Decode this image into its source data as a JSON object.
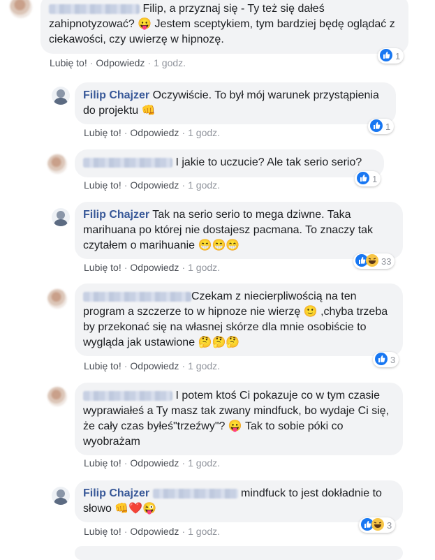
{
  "actions": {
    "like": "Lubię to!",
    "reply": "Odpowiedz",
    "time": "1 godz."
  },
  "colors": {
    "author": "#385898",
    "bubble": "#f2f3f5",
    "like_blue": "#1877f2"
  },
  "comments": [
    {
      "author": "",
      "text": "Filip, a przyznaj się - Ty też się dałeś zahipnotyzować? 😛 Jestem sceptykiem, tym bardziej będę oglądać z ciekawości, czy uwierzę w hipnozę.",
      "reaction_count": "1",
      "reactions": [
        "like-icon"
      ]
    },
    {
      "author": "Filip Chajzer",
      "text": "Oczywiście. To był mój warunek przystąpienia do projektu 👊",
      "reaction_count": "1",
      "reactions": [
        "like-icon"
      ]
    },
    {
      "author": "",
      "text": "I jakie to uczucie? Ale tak serio serio?",
      "reaction_count": "1",
      "reactions": [
        "like-icon"
      ]
    },
    {
      "author": "Filip Chajzer",
      "text": "Tak na serio serio to mega dziwne. Taka marihuana po której nie dostajesz pacmana. To znaczy tak czytałem o marihuanie 😁😁😁",
      "reaction_count": "33",
      "reactions": [
        "like-icon",
        "laugh-icon"
      ]
    },
    {
      "author": "",
      "text": "Czekam z niecierpliwością na ten program a szczerze to w hipnoze nie wierzę 🙂 ,chyba trzeba by przekonać się na własnej skórze dla mnie osobiście to wygląda jak ustawione 🤔🤔🤔",
      "reaction_count": "3",
      "reactions": [
        "like-icon"
      ]
    },
    {
      "author": "",
      "text": "I potem ktoś Ci pokazuje co w tym czasie wyprawiałeś a Ty masz tak zwany mindfuck, bo wydaje Ci się, że cały czas byłeś\"trzeźwy\"? 😛 Tak to sobie póki co wyobrażam",
      "reaction_count": "",
      "reactions": []
    },
    {
      "author": "Filip Chajzer",
      "text": "mindfuck to jest dokładnie to słowo 👊❤️😜",
      "reaction_count": "3",
      "reactions": [
        "like-icon",
        "laugh-icon"
      ]
    }
  ]
}
